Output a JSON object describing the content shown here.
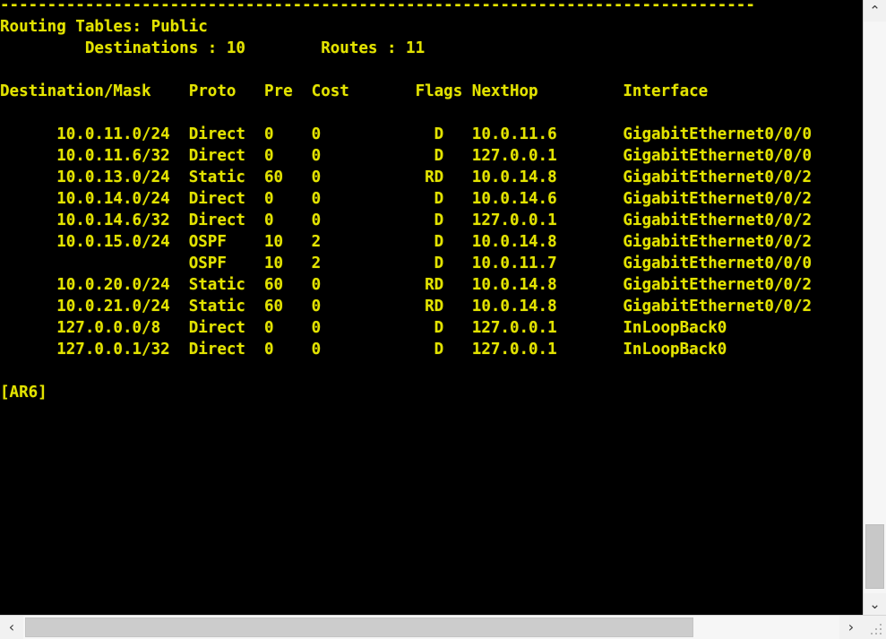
{
  "terminal": {
    "foreground_color": "#e3e300",
    "background_color": "#000000",
    "separator_line": "--------------------------------------------------------------------------------",
    "routing_table_label": "Routing Tables: Public",
    "summary_line": "        Destinations : 10        Routes : 11",
    "summary": {
      "destinations_label": "Destinations",
      "destinations_value": "10",
      "routes_label": "Routes",
      "routes_value": "11"
    },
    "columns": [
      "Destination/Mask",
      "Proto",
      "Pre",
      "Cost",
      "Flags",
      "NextHop",
      "Interface"
    ],
    "header_line": "Destination/Mask    Proto   Pre  Cost        Flags NextHop         Interface",
    "routes": [
      {
        "destination": "10.0.11.0/24",
        "proto": "Direct",
        "pre": "0",
        "cost": "0",
        "flags": "D",
        "nexthop": "10.0.11.6",
        "interface": "GigabitEthernet0/0/0"
      },
      {
        "destination": "10.0.11.6/32",
        "proto": "Direct",
        "pre": "0",
        "cost": "0",
        "flags": "D",
        "nexthop": "127.0.0.1",
        "interface": "GigabitEthernet0/0/0"
      },
      {
        "destination": "10.0.13.0/24",
        "proto": "Static",
        "pre": "60",
        "cost": "0",
        "flags": "RD",
        "nexthop": "10.0.14.8",
        "interface": "GigabitEthernet0/0/2"
      },
      {
        "destination": "10.0.14.0/24",
        "proto": "Direct",
        "pre": "0",
        "cost": "0",
        "flags": "D",
        "nexthop": "10.0.14.6",
        "interface": "GigabitEthernet0/0/2"
      },
      {
        "destination": "10.0.14.6/32",
        "proto": "Direct",
        "pre": "0",
        "cost": "0",
        "flags": "D",
        "nexthop": "127.0.0.1",
        "interface": "GigabitEthernet0/0/2"
      },
      {
        "destination": "10.0.15.0/24",
        "proto": "OSPF",
        "pre": "10",
        "cost": "2",
        "flags": "D",
        "nexthop": "10.0.14.8",
        "interface": "GigabitEthernet0/0/2"
      },
      {
        "destination": "",
        "proto": "OSPF",
        "pre": "10",
        "cost": "2",
        "flags": "D",
        "nexthop": "10.0.11.7",
        "interface": "GigabitEthernet0/0/0"
      },
      {
        "destination": "10.0.20.0/24",
        "proto": "Static",
        "pre": "60",
        "cost": "0",
        "flags": "RD",
        "nexthop": "10.0.14.8",
        "interface": "GigabitEthernet0/0/2"
      },
      {
        "destination": "10.0.21.0/24",
        "proto": "Static",
        "pre": "60",
        "cost": "0",
        "flags": "RD",
        "nexthop": "10.0.14.8",
        "interface": "GigabitEthernet0/0/2"
      },
      {
        "destination": "127.0.0.0/8",
        "proto": "Direct",
        "pre": "0",
        "cost": "0",
        "flags": "D",
        "nexthop": "127.0.0.1",
        "interface": "InLoopBack0"
      },
      {
        "destination": "127.0.0.1/32",
        "proto": "Direct",
        "pre": "0",
        "cost": "0",
        "flags": "D",
        "nexthop": "127.0.0.1",
        "interface": "InLoopBack0"
      }
    ],
    "prompt": "[AR6]",
    "screen_text": "--------------------------------------------------------------------------------\nRouting Tables: Public\n         Destinations : 10        Routes : 11\n\nDestination/Mask    Proto   Pre  Cost       Flags NextHop         Interface\n\n      10.0.11.0/24  Direct  0    0            D   10.0.11.6       GigabitEthernet0/0/0\n      10.0.11.6/32  Direct  0    0            D   127.0.0.1       GigabitEthernet0/0/0\n      10.0.13.0/24  Static  60   0           RD   10.0.14.8       GigabitEthernet0/0/2\n      10.0.14.0/24  Direct  0    0            D   10.0.14.6       GigabitEthernet0/0/2\n      10.0.14.6/32  Direct  0    0            D   127.0.0.1       GigabitEthernet0/0/2\n      10.0.15.0/24  OSPF    10   2            D   10.0.14.8       GigabitEthernet0/0/2\n                    OSPF    10   2            D   10.0.11.7       GigabitEthernet0/0/0\n      10.0.20.0/24  Static  60   0           RD   10.0.14.8       GigabitEthernet0/0/2\n      10.0.21.0/24  Static  60   0           RD   10.0.14.8       GigabitEthernet0/0/2\n      127.0.0.0/8   Direct  0    0            D   127.0.0.1       InLoopBack0\n      127.0.0.1/32  Direct  0    0            D   127.0.0.1       InLoopBack0\n\n[AR6]"
  },
  "scrollbars": {
    "vertical": {
      "up_arrow": "⌃",
      "down_arrow": "⌄"
    },
    "horizontal": {
      "left_arrow": "‹",
      "right_arrow": "›"
    }
  }
}
